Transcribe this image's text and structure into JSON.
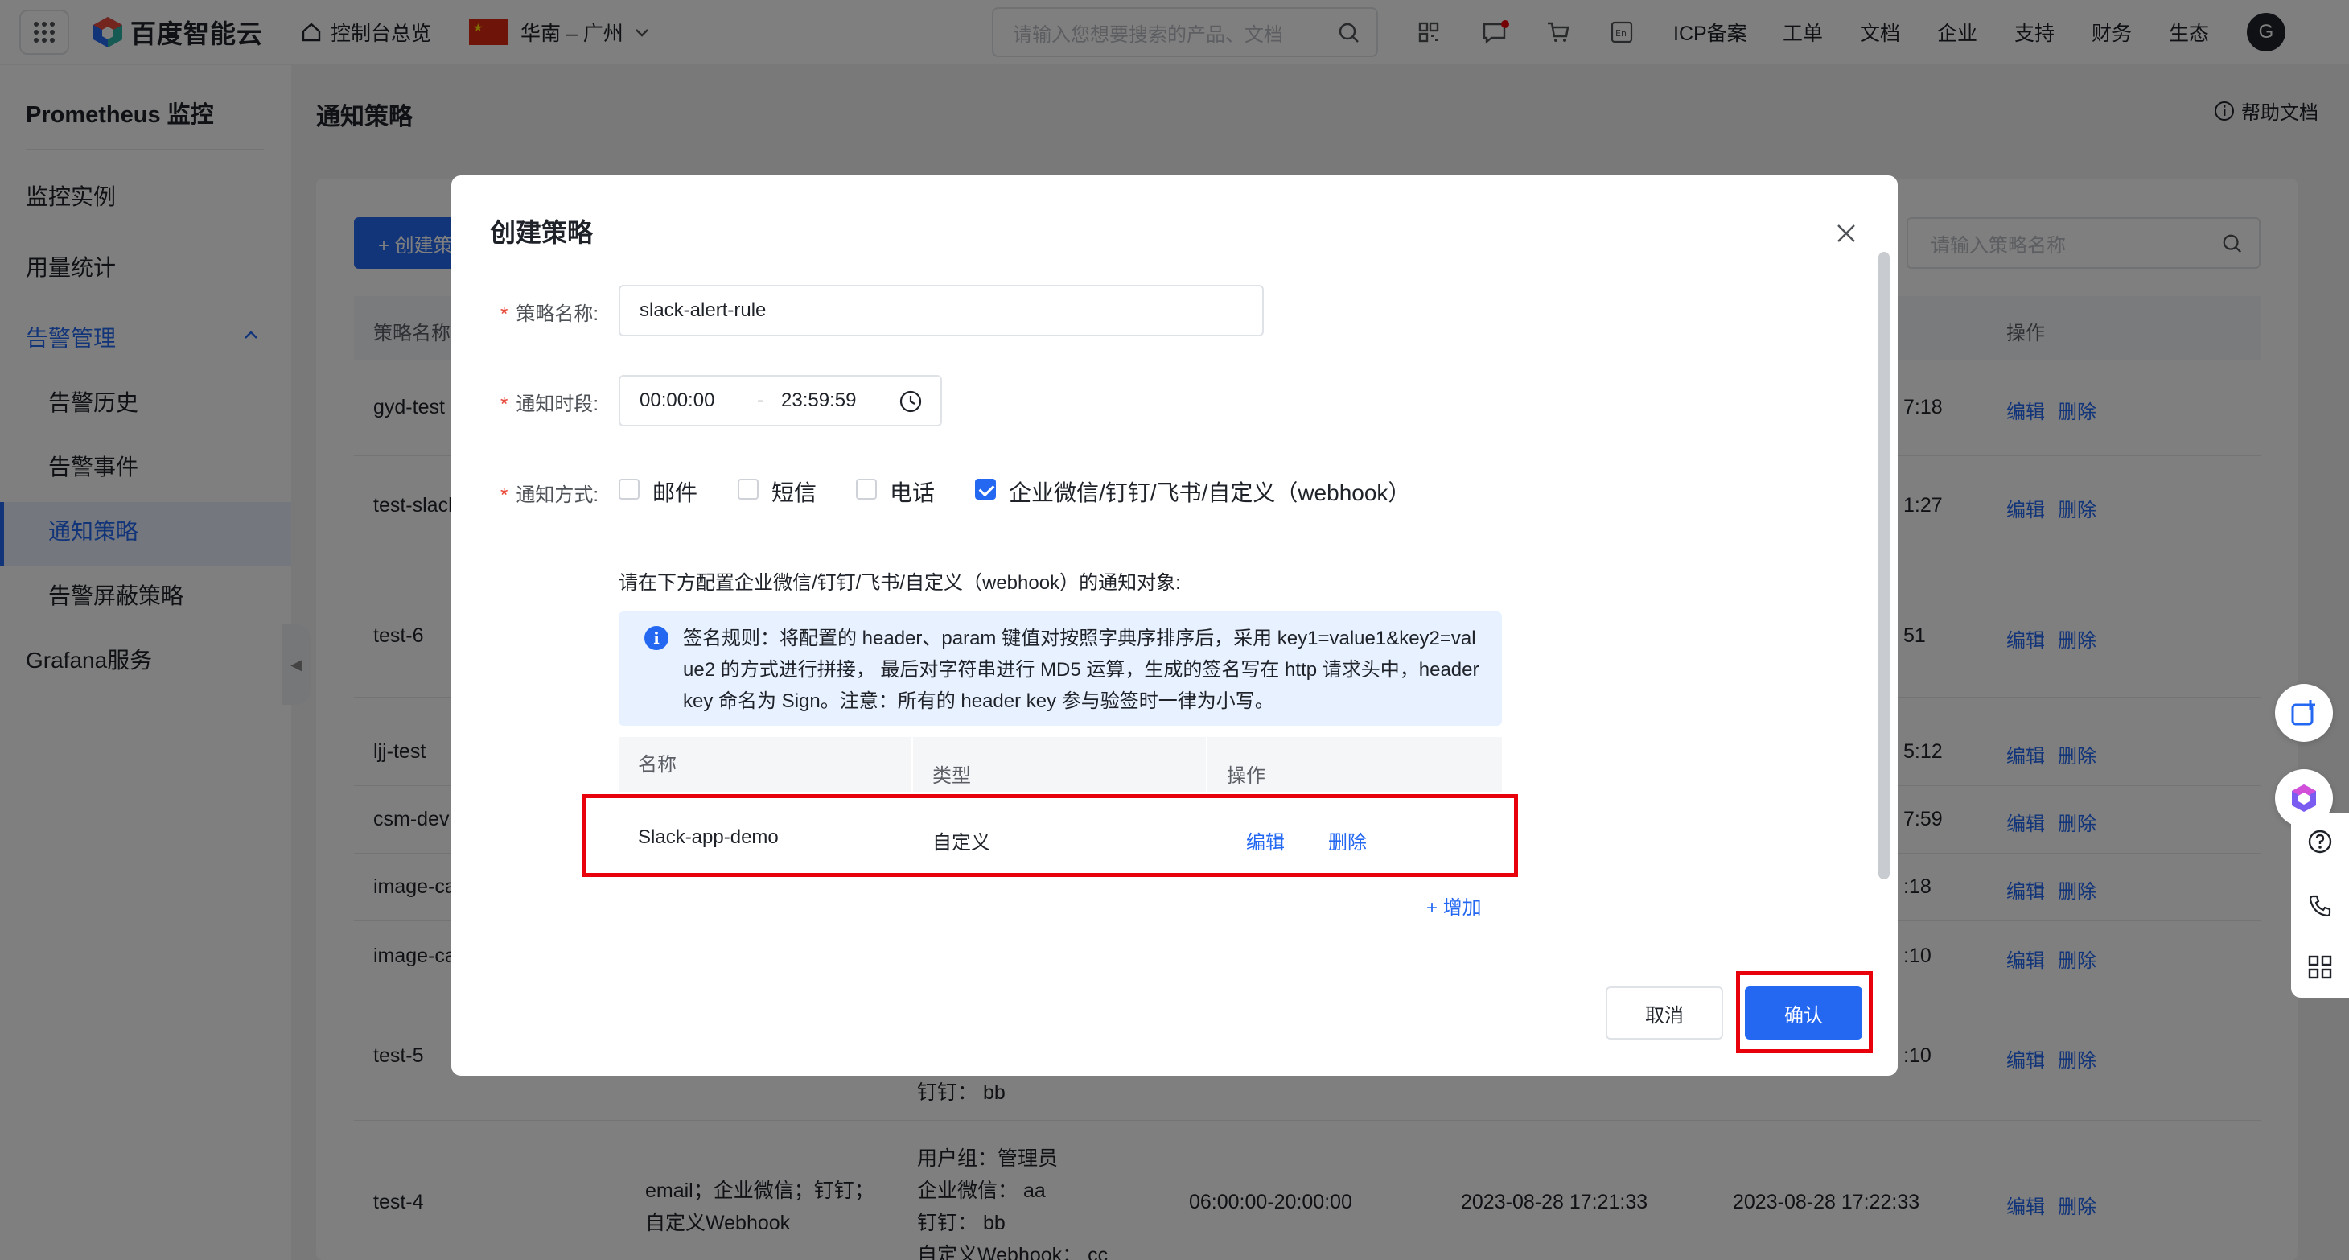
{
  "topbar": {
    "logo": "百度智能云",
    "console_home": "控制台总览",
    "region": "华南 – 广州",
    "search_placeholder": "请输入您想要搜索的产品、文档",
    "icp": "ICP备案",
    "ticket": "工单",
    "docs": "文档",
    "enterprise": "企业",
    "support": "支持",
    "finance": "财务",
    "ecosystem": "生态",
    "avatar": "G"
  },
  "sidebar": {
    "title": "Prometheus 监控",
    "items": [
      {
        "label": "监控实例"
      },
      {
        "label": "用量统计"
      },
      {
        "label": "告警管理"
      },
      {
        "label": "告警历史"
      },
      {
        "label": "告警事件"
      },
      {
        "label": "通知策略"
      },
      {
        "label": "告警屏蔽策略"
      },
      {
        "label": "Grafana服务"
      }
    ]
  },
  "main": {
    "page_title": "通知策略",
    "help": "帮助文档",
    "create_btn": "+ 创建策略",
    "search_placeholder": "请输入策略名称",
    "col_name": "策略名称",
    "col_ops": "操作",
    "edit": "编辑",
    "delete": "删除",
    "rows": [
      {
        "name": "gyd-test",
        "time_frag": "7:18"
      },
      {
        "name": "test-slack",
        "time_frag": "1:27"
      },
      {
        "name": "test-6",
        "time_frag": "51"
      },
      {
        "name": "ljj-test",
        "time_frag": "5:12"
      },
      {
        "name": "csm-dev",
        "time_frag": "7:59"
      },
      {
        "name": "image-ca",
        "time_frag": ":18"
      },
      {
        "name": "image-ca",
        "time_frag": ":10"
      },
      {
        "name": "test-5",
        "time_frag": ":10",
        "extra": "钉钉：  bb"
      },
      {
        "name": "test-4",
        "methods_line1": "email；企业微信；钉钉；",
        "methods_line2": "自定义Webhook",
        "targets": [
          "用户组：管理员",
          "企业微信：  aa",
          "钉钉：  bb",
          "自定义Webhook：  cc"
        ],
        "period": "06:00:00-20:00:00",
        "created": "2023-08-28 17:21:33",
        "updated": "2023-08-28 17:22:33"
      }
    ]
  },
  "modal": {
    "title": "创建策略",
    "name_label": "策略名称:",
    "name_value": "slack-alert-rule",
    "period_label": "通知时段:",
    "time_start": "00:00:00",
    "time_sep": "-",
    "time_end": "23:59:59",
    "method_label": "通知方式:",
    "methods": [
      {
        "label": "邮件",
        "checked": false
      },
      {
        "label": "短信",
        "checked": false
      },
      {
        "label": "电话",
        "checked": false
      },
      {
        "label": "企业微信/钉钉/飞书/自定义（webhook）",
        "checked": true
      }
    ],
    "hint": "请在下方配置企业微信/钉钉/飞书/自定义（webhook）的通知对象:",
    "info": "签名规则：将配置的 header、param 键值对按照字典序排序后，采用 key1=value1&key2=value2 的方式进行拼接， 最后对字符串进行 MD5 运算，生成的签名写在 http 请求头中，header key 命名为 Sign。注意：所有的 header key 参与验签时一律为小写。",
    "table": {
      "col_name": "名称",
      "col_type": "类型",
      "col_ops": "操作",
      "rows": [
        {
          "name": "Slack-app-demo",
          "type": "自定义",
          "edit": "编辑",
          "delete": "删除"
        }
      ]
    },
    "add": "+ 增加",
    "cancel": "取消",
    "ok": "确认"
  },
  "colors": {
    "primary": "#2468f2",
    "highlight_box": "#e8000b"
  }
}
